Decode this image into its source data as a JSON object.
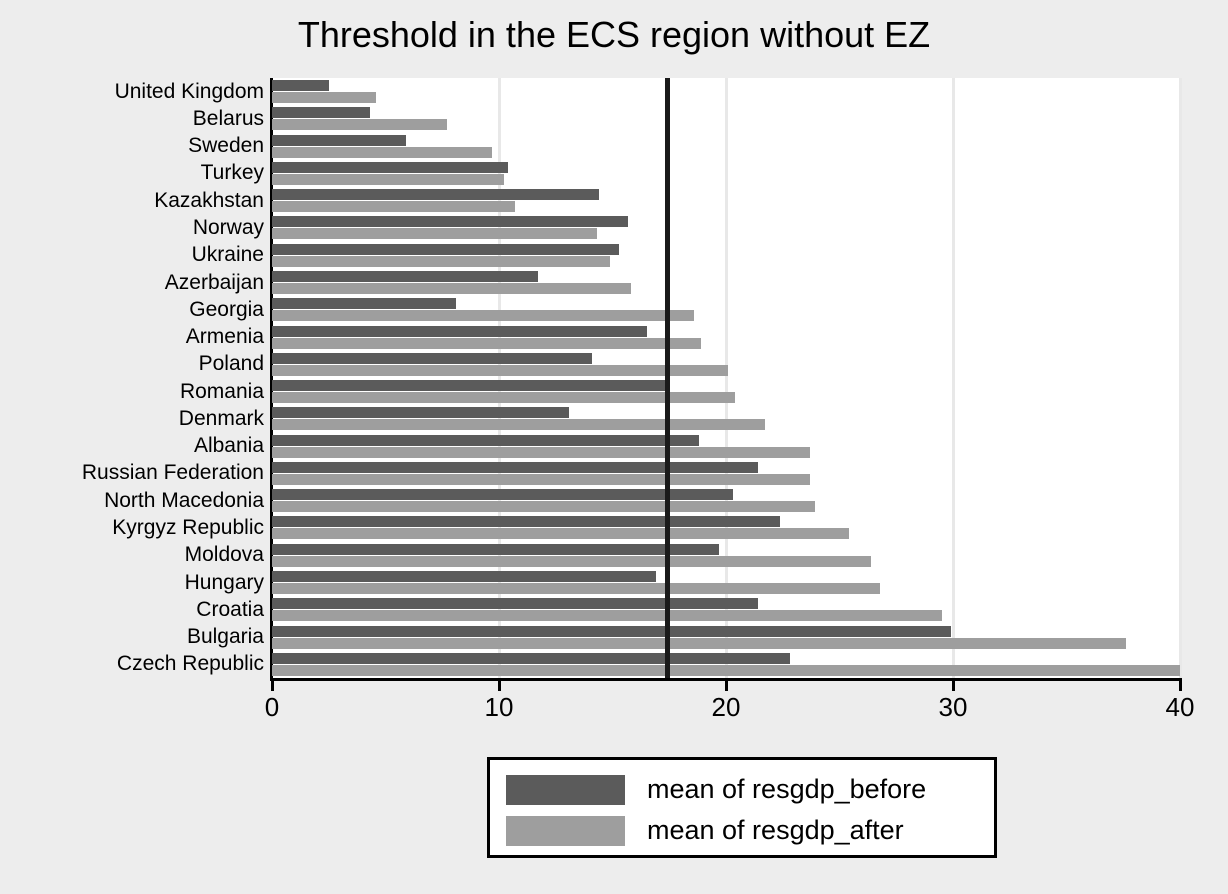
{
  "chart_data": {
    "type": "bar",
    "orientation": "horizontal",
    "title": "Threshold in the ECS region without EZ",
    "xlabel": "",
    "ylabel": "",
    "xlim": [
      0,
      40
    ],
    "xticks": [
      0,
      10,
      20,
      30,
      40
    ],
    "xtick_labels": [
      "0",
      "10",
      "20",
      "30",
      "40"
    ],
    "grid": true,
    "grid_axis": "x",
    "legend_position": "bottom-center",
    "categories": [
      "United Kingdom",
      "Belarus",
      "Sweden",
      "Turkey",
      "Kazakhstan",
      "Norway",
      "Ukraine",
      "Azerbaijan",
      "Georgia",
      "Armenia",
      "Poland",
      "Romania",
      "Denmark",
      "Albania",
      "Russian Federation",
      "North Macedonia",
      "Kyrgyz Republic",
      "Moldova",
      "Hungary",
      "Croatia",
      "Bulgaria",
      "Czech Republic"
    ],
    "series": [
      {
        "name": "mean of resgdp_before",
        "color": "#5b5b5b",
        "values": [
          2.5,
          4.3,
          5.9,
          10.4,
          14.4,
          15.7,
          15.3,
          11.7,
          8.1,
          16.5,
          14.1,
          17.4,
          13.1,
          18.8,
          21.4,
          20.3,
          22.4,
          19.7,
          16.9,
          21.4,
          29.9,
          22.8
        ]
      },
      {
        "name": "mean of resgdp_after",
        "color": "#9e9e9e",
        "values": [
          4.6,
          7.7,
          9.7,
          10.2,
          10.7,
          14.3,
          14.9,
          15.8,
          18.6,
          18.9,
          20.1,
          20.4,
          21.7,
          23.7,
          23.7,
          23.9,
          25.4,
          26.4,
          26.8,
          29.5,
          37.6,
          40.0
        ]
      }
    ],
    "annotations": [
      {
        "name": "threshold-line",
        "type": "vline",
        "value": 17.4,
        "color": "#1a1a1a"
      }
    ]
  },
  "legend": {
    "items": [
      {
        "label": "mean of resgdp_before",
        "color": "#5b5b5b"
      },
      {
        "label": "mean of resgdp_after",
        "color": "#9e9e9e"
      }
    ]
  },
  "colors": {
    "background": "#ededed",
    "plot_background": "#ffffff",
    "grid": "#e8e8e8",
    "axis": "#000000",
    "before": "#5b5b5b",
    "after": "#9e9e9e",
    "threshold": "#1a1a1a"
  }
}
